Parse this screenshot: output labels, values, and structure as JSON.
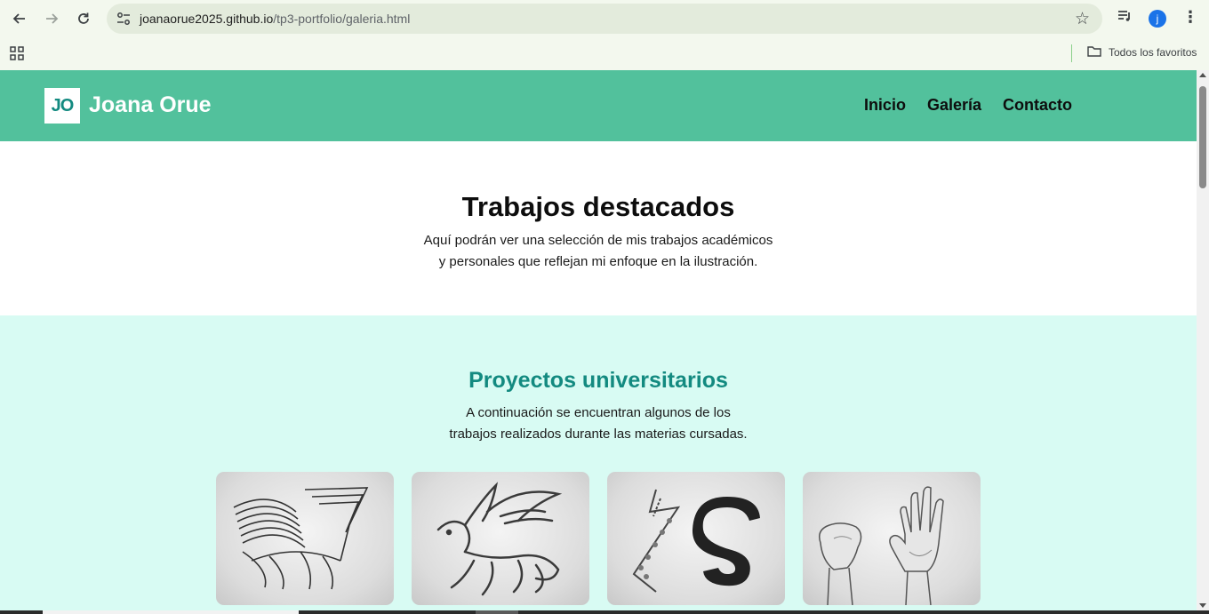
{
  "browser": {
    "url_host": "joanaorue2025.github.io",
    "url_path": "/tp3-portfolio/galeria.html",
    "profile_initial": "j",
    "bookmarks_folder": "Todos los favoritos",
    "icons": [
      "back-arrow-icon",
      "forward-arrow-icon",
      "reload-icon",
      "site-settings-icon",
      "bookmark-star-icon",
      "media-queue-icon",
      "more-menu-icon",
      "apps-grid-icon",
      "folder-icon"
    ]
  },
  "site": {
    "logo_initials": "JO",
    "logo_name": "Joana Orue",
    "nav": [
      "Inicio",
      "Galería",
      "Contacto"
    ]
  },
  "hero": {
    "title": "Trabajos destacados",
    "line1": "Aquí podrán ver una selección de mis trabajos académicos",
    "line2": "y personales que reflejan mi enfoque en la ilustración."
  },
  "projects": {
    "title": "Proyectos universitarios",
    "line1": "A continuación se encuentran algunos de los",
    "line2": "trabajos realizados durante las materias cursadas.",
    "gallery": [
      "griffin-lines-drawing",
      "eagle-lion-drawing",
      "letters-drawing",
      "hands-drawing"
    ]
  },
  "colors": {
    "header": "#52c19c",
    "section_bg": "#d8fbf3",
    "accent_teal": "#138a80"
  }
}
